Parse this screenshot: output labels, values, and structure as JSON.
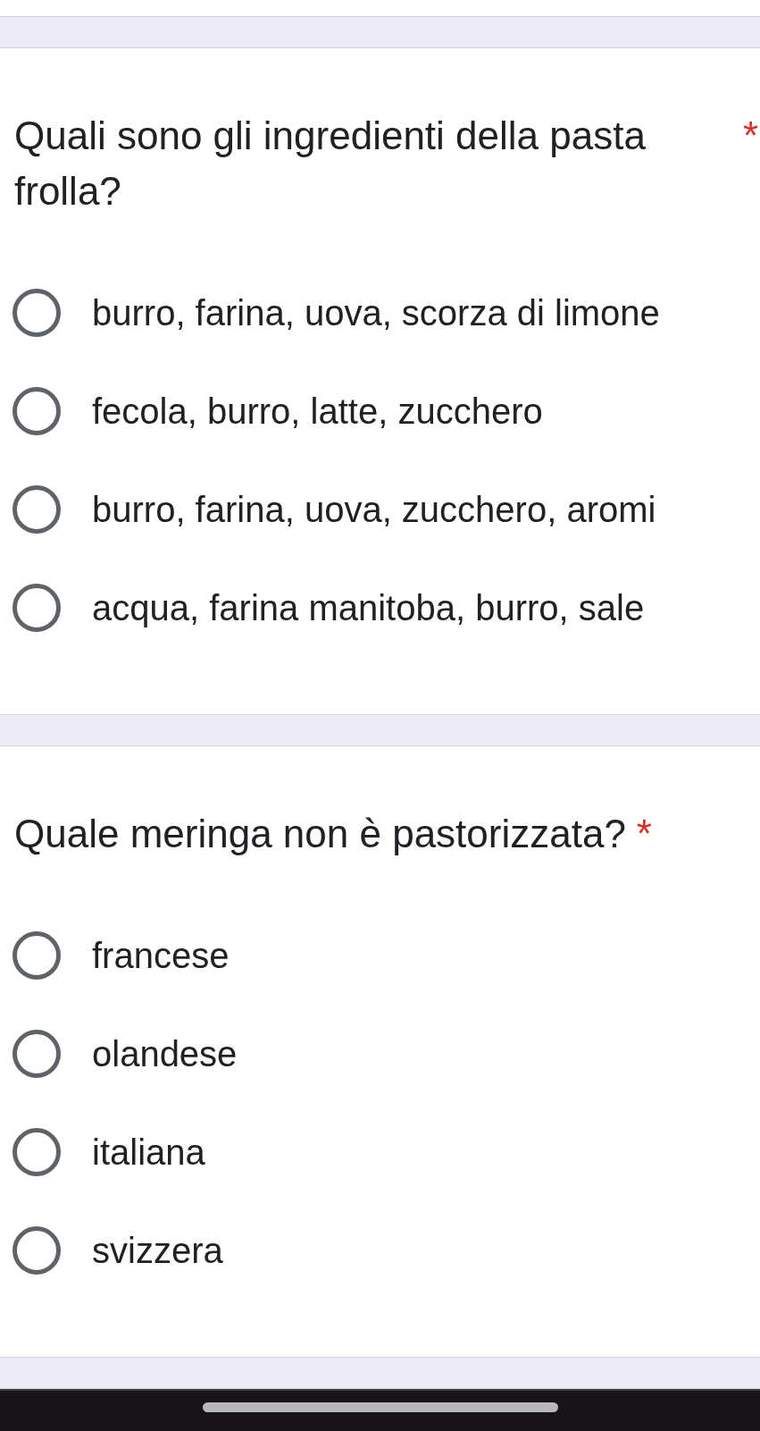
{
  "questions": [
    {
      "title": "Quali sono gli ingredienti della pasta frolla?",
      "required_mark": "*",
      "options": [
        {
          "label": "burro, farina, uova, scorza di limone",
          "selected": false
        },
        {
          "label": "fecola, burro, latte, zucchero",
          "selected": false
        },
        {
          "label": "burro, farina, uova, zucchero, aromi",
          "selected": false
        },
        {
          "label": "acqua, farina manitoba, burro, sale",
          "selected": false
        }
      ]
    },
    {
      "title": "Quale meringa non è pastorizzata?",
      "required_mark": "*",
      "options": [
        {
          "label": "francese",
          "selected": false
        },
        {
          "label": "olandese",
          "selected": false
        },
        {
          "label": "italiana",
          "selected": false
        },
        {
          "label": "svizzera",
          "selected": false
        }
      ]
    }
  ]
}
